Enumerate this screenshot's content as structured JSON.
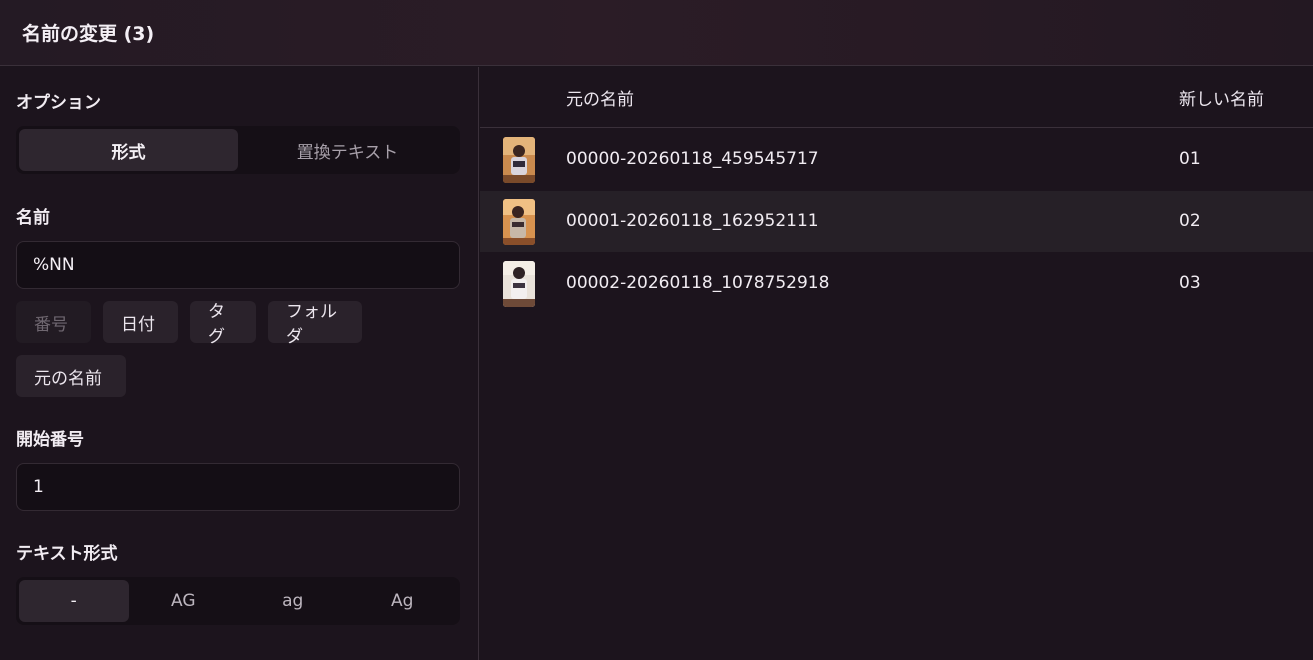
{
  "header": {
    "title": "名前の変更 (3)"
  },
  "options": {
    "label": "オプション",
    "tabs": [
      {
        "label": "形式",
        "active": true
      },
      {
        "label": "置換テキスト",
        "active": false
      }
    ]
  },
  "name": {
    "label": "名前",
    "value": "%NN",
    "tokens": [
      {
        "label": "番号",
        "disabled": true
      },
      {
        "label": "日付",
        "disabled": false
      },
      {
        "label": "タグ",
        "disabled": false
      },
      {
        "label": "フォルダ",
        "disabled": false
      },
      {
        "label": "元の名前",
        "disabled": false
      }
    ]
  },
  "start_number": {
    "label": "開始番号",
    "value": "1"
  },
  "text_format": {
    "label": "テキスト形式",
    "options": [
      {
        "label": "-",
        "active": true
      },
      {
        "label": "AG",
        "active": false
      },
      {
        "label": "ag",
        "active": false
      },
      {
        "label": "Ag",
        "active": false
      }
    ]
  },
  "table": {
    "col_original": "元の名前",
    "col_new": "新しい名前",
    "rows": [
      {
        "original": "00000-20260118_459545717",
        "new": "01",
        "thumb_icon": "image-thumbnail-icon"
      },
      {
        "original": "00001-20260118_162952111",
        "new": "02",
        "thumb_icon": "image-thumbnail-icon"
      },
      {
        "original": "00002-20260118_1078752918",
        "new": "03",
        "thumb_icon": "image-thumbnail-icon"
      }
    ]
  },
  "colors": {
    "background": "#1c141d",
    "active_segment": "#2e262f",
    "chip": "#2a222b",
    "alt_row": "#262027"
  }
}
